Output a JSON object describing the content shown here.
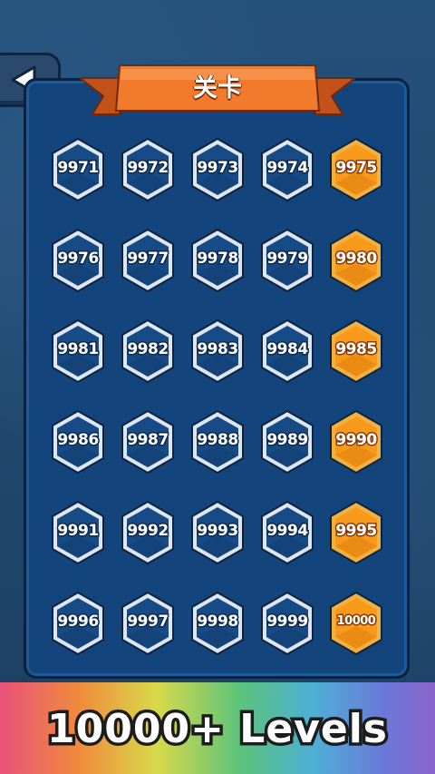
{
  "header": {
    "title": "关卡"
  },
  "back_button": {
    "icon": "back-arrow-icon"
  },
  "levels": [
    {
      "num": "9971",
      "state": "normal"
    },
    {
      "num": "9972",
      "state": "normal"
    },
    {
      "num": "9973",
      "state": "normal"
    },
    {
      "num": "9974",
      "state": "normal"
    },
    {
      "num": "9975",
      "state": "milestone"
    },
    {
      "num": "9976",
      "state": "normal"
    },
    {
      "num": "9977",
      "state": "normal"
    },
    {
      "num": "9978",
      "state": "normal"
    },
    {
      "num": "9979",
      "state": "normal"
    },
    {
      "num": "9980",
      "state": "milestone"
    },
    {
      "num": "9981",
      "state": "normal"
    },
    {
      "num": "9982",
      "state": "normal"
    },
    {
      "num": "9983",
      "state": "normal"
    },
    {
      "num": "9984",
      "state": "normal"
    },
    {
      "num": "9985",
      "state": "milestone"
    },
    {
      "num": "9986",
      "state": "normal"
    },
    {
      "num": "9987",
      "state": "normal"
    },
    {
      "num": "9988",
      "state": "normal"
    },
    {
      "num": "9989",
      "state": "normal"
    },
    {
      "num": "9990",
      "state": "milestone"
    },
    {
      "num": "9991",
      "state": "normal"
    },
    {
      "num": "9992",
      "state": "normal"
    },
    {
      "num": "9993",
      "state": "normal"
    },
    {
      "num": "9994",
      "state": "normal"
    },
    {
      "num": "9995",
      "state": "milestone"
    },
    {
      "num": "9996",
      "state": "normal"
    },
    {
      "num": "9997",
      "state": "normal"
    },
    {
      "num": "9998",
      "state": "normal"
    },
    {
      "num": "9999",
      "state": "normal"
    },
    {
      "num": "10000",
      "state": "milestone"
    }
  ],
  "banner": {
    "text": "10000+ Levels"
  },
  "colors": {
    "background": "#1f4468",
    "panel": "#13447b",
    "ribbon": "#f27a2c",
    "level_fill": "#164b85",
    "level_border": "#dfe6f2",
    "milestone_fill": "#f79a1b"
  }
}
